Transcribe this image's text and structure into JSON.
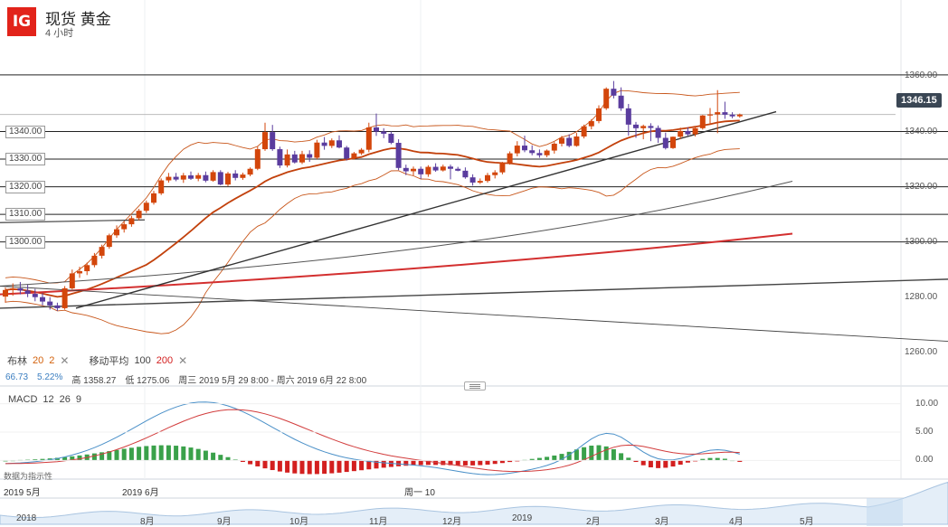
{
  "header": {
    "logo": "IG",
    "title": "现货 黄金",
    "timeframe": "4 小时"
  },
  "price_axis": {
    "labels": [
      {
        "text": "1360.00",
        "value": 1360,
        "boxed": false
      },
      {
        "text": "1340.00",
        "value": 1340,
        "boxed": false
      },
      {
        "text": "1320.00",
        "value": 1320,
        "boxed": false
      },
      {
        "text": "1300.00",
        "value": 1300,
        "boxed": false
      },
      {
        "text": "1280.00",
        "value": 1280,
        "boxed": false
      },
      {
        "text": "1260.00",
        "value": 1260,
        "boxed": false
      }
    ],
    "left_labels": [
      {
        "text": "1340.00",
        "value": 1340
      },
      {
        "text": "1330.00",
        "value": 1330
      },
      {
        "text": "1320.00",
        "value": 1320
      },
      {
        "text": "1310.00",
        "value": 1310
      },
      {
        "text": "1300.00",
        "value": 1300
      }
    ],
    "current_price": "1346.15"
  },
  "levels": [
    1360.5,
    1340,
    1330,
    1320,
    1310,
    1300
  ],
  "indicators_legend": {
    "bollinger": {
      "name": "布林",
      "p1": "20",
      "p2": "2"
    },
    "ma": {
      "name": "移动平均",
      "p1": "100",
      "p2": "200"
    },
    "close": "✕"
  },
  "stats": {
    "v1": "66.73",
    "v2": "5.22%",
    "high": "高 1358.27",
    "low": "低 1275.06",
    "range": "周三 2019 5月 29 8:00 - 周六 2019 6月 22 8:00"
  },
  "macd": {
    "label": "MACD",
    "p1": "12",
    "p2": "26",
    "p3": "9",
    "axis": [
      {
        "text": "10.00",
        "value": 10
      },
      {
        "text": "5.00",
        "value": 5
      },
      {
        "text": "0.00",
        "value": 0
      }
    ],
    "note": "数据为指示性"
  },
  "date_axis": [
    "2019 5月",
    "2019 6月",
    "周一 10"
  ],
  "navigator": [
    "2018",
    "8月",
    "9月",
    "10月",
    "11月",
    "12月",
    "2019",
    "2月",
    "3月",
    "4月",
    "5月"
  ],
  "colors": {
    "up": "#d3460b",
    "down": "#5a3c9e",
    "ma100": "#555555",
    "ma200": "#d32f2f",
    "bb": "#c8561a",
    "macd_pos": "#3aa14a",
    "macd_neg": "#d31f1f"
  },
  "chart_data": {
    "type": "candlestick",
    "ylim": [
      1256,
      1368
    ],
    "candles": [
      [
        1280.2,
        1283.5,
        1278,
        1282.6
      ],
      [
        1282.6,
        1285,
        1280.5,
        1283.2
      ],
      [
        1283.2,
        1285.5,
        1281,
        1282.4
      ],
      [
        1282.4,
        1284.5,
        1280,
        1281.2
      ],
      [
        1281.2,
        1283,
        1278.5,
        1280
      ],
      [
        1280,
        1281.5,
        1277,
        1278.4
      ],
      [
        1278.4,
        1280,
        1275.5,
        1277
      ],
      [
        1277,
        1278,
        1275,
        1276
      ],
      [
        1276,
        1284,
        1275.5,
        1283.2
      ],
      [
        1283.2,
        1290,
        1282.8,
        1288.6
      ],
      [
        1288.6,
        1291,
        1287,
        1289.4
      ],
      [
        1289.4,
        1292.5,
        1288,
        1291.6
      ],
      [
        1291.6,
        1296,
        1290.8,
        1295
      ],
      [
        1295,
        1299,
        1294,
        1298.2
      ],
      [
        1298.2,
        1303,
        1297.5,
        1302.4
      ],
      [
        1302.4,
        1306,
        1301.5,
        1304.6
      ],
      [
        1304.6,
        1307.5,
        1303.4,
        1306.4
      ],
      [
        1306.4,
        1309.5,
        1305.5,
        1308.6
      ],
      [
        1308.6,
        1312,
        1307.8,
        1311.3
      ],
      [
        1311.3,
        1315,
        1310.5,
        1314.2
      ],
      [
        1314.2,
        1318.5,
        1313.5,
        1317.6
      ],
      [
        1317.6,
        1323,
        1317,
        1322.3
      ],
      [
        1322.3,
        1325,
        1321.5,
        1323.6
      ],
      [
        1323.6,
        1325,
        1322,
        1322.6
      ],
      [
        1322.6,
        1325,
        1321.4,
        1324.1
      ],
      [
        1324.1,
        1325.5,
        1322.5,
        1322.9
      ],
      [
        1322.9,
        1325,
        1322,
        1324.2
      ],
      [
        1324.2,
        1325.5,
        1321.6,
        1322.2
      ],
      [
        1322.2,
        1326,
        1321.8,
        1325.3
      ],
      [
        1325.3,
        1326,
        1320.5,
        1320.8
      ],
      [
        1320.8,
        1325.4,
        1320.2,
        1324.8
      ],
      [
        1324.8,
        1326,
        1322.3,
        1323.2
      ],
      [
        1323.2,
        1325.1,
        1322.5,
        1324.4
      ],
      [
        1324.4,
        1327,
        1323.8,
        1326.5
      ],
      [
        1326.5,
        1334.5,
        1326,
        1333.6
      ],
      [
        1333.6,
        1343.2,
        1333,
        1339.8
      ],
      [
        1339.8,
        1342.4,
        1333,
        1333.6
      ],
      [
        1333.6,
        1334.5,
        1326.8,
        1327.7
      ],
      [
        1327.7,
        1333.5,
        1327,
        1331.7
      ],
      [
        1331.7,
        1333,
        1328.4,
        1328.8
      ],
      [
        1328.8,
        1333,
        1328.2,
        1331.8
      ],
      [
        1331.8,
        1333.2,
        1329,
        1330.5
      ],
      [
        1330.5,
        1337,
        1330,
        1336
      ],
      [
        1336,
        1338,
        1333.4,
        1334.8
      ],
      [
        1334.8,
        1337.5,
        1334,
        1336.8
      ],
      [
        1336.8,
        1338.6,
        1333.9,
        1334.2
      ],
      [
        1334.2,
        1334.8,
        1329.5,
        1330.2
      ],
      [
        1330.2,
        1332.6,
        1329.8,
        1332.1
      ],
      [
        1332.1,
        1334,
        1331.5,
        1333.4
      ],
      [
        1333.4,
        1343.2,
        1332.5,
        1341.5
      ],
      [
        1341.5,
        1346.5,
        1338.4,
        1340
      ],
      [
        1340,
        1341.2,
        1337.6,
        1339.2
      ],
      [
        1339.2,
        1340,
        1335.4,
        1335.9
      ],
      [
        1335.9,
        1337.2,
        1326,
        1326.8
      ],
      [
        1326.8,
        1328,
        1324.2,
        1325.6
      ],
      [
        1325.6,
        1327.3,
        1324.1,
        1326.5
      ],
      [
        1326.5,
        1327.3,
        1322.8,
        1324.5
      ],
      [
        1324.5,
        1327.8,
        1323.6,
        1327.2
      ],
      [
        1327.2,
        1328.5,
        1325.4,
        1325.9
      ],
      [
        1325.9,
        1328,
        1325.5,
        1327.3
      ],
      [
        1327.3,
        1328,
        1322.7,
        1326.5
      ],
      [
        1326.5,
        1327.2,
        1325.6,
        1325.8
      ],
      [
        1325.8,
        1327,
        1322.9,
        1323.4
      ],
      [
        1323.4,
        1324.5,
        1320.4,
        1321.5
      ],
      [
        1321.5,
        1323,
        1321,
        1322.1
      ],
      [
        1322.1,
        1325,
        1321.5,
        1324.2
      ],
      [
        1324.2,
        1326,
        1323,
        1325.2
      ],
      [
        1325.2,
        1329,
        1324.5,
        1328.7
      ],
      [
        1328.7,
        1332.8,
        1328,
        1332.1
      ],
      [
        1332.1,
        1336.5,
        1331,
        1334.9
      ],
      [
        1334.9,
        1338.5,
        1332.5,
        1333.2
      ],
      [
        1333.2,
        1335,
        1331.4,
        1332.2
      ],
      [
        1332.2,
        1333.5,
        1330.5,
        1331.4
      ],
      [
        1331.4,
        1333.5,
        1330.7,
        1333.1
      ],
      [
        1333.1,
        1336.2,
        1332,
        1335.6
      ],
      [
        1335.6,
        1338.4,
        1334.6,
        1337.7
      ],
      [
        1337.7,
        1339,
        1334.3,
        1334.8
      ],
      [
        1334.8,
        1339.5,
        1334.5,
        1338.2
      ],
      [
        1338.2,
        1342.5,
        1337.5,
        1341.9
      ],
      [
        1341.9,
        1344.5,
        1340.8,
        1343.8
      ],
      [
        1343.8,
        1349.5,
        1343,
        1348.4
      ],
      [
        1348.4,
        1356,
        1347.8,
        1355.5
      ],
      [
        1355.5,
        1358.3,
        1352,
        1353
      ],
      [
        1353,
        1356,
        1347.5,
        1348.4
      ],
      [
        1348.4,
        1350,
        1338.5,
        1342.5
      ],
      [
        1342.5,
        1343.5,
        1337.7,
        1341.2
      ],
      [
        1341.2,
        1342.5,
        1337.2,
        1342
      ],
      [
        1342,
        1343,
        1336.5,
        1341.3
      ],
      [
        1341.3,
        1342.2,
        1335.9,
        1337.7
      ],
      [
        1337.7,
        1339.6,
        1333.5,
        1334
      ],
      [
        1334,
        1338.2,
        1333.7,
        1338.1
      ],
      [
        1338.1,
        1341.4,
        1337.2,
        1340.2
      ],
      [
        1340.2,
        1341.5,
        1338.4,
        1339
      ],
      [
        1339,
        1342,
        1338.2,
        1341.2
      ],
      [
        1341.2,
        1346,
        1340.7,
        1345.8
      ],
      [
        1345.8,
        1348.5,
        1342.4,
        1346.2
      ],
      [
        1346.2,
        1355,
        1339.4,
        1347
      ],
      [
        1347,
        1350.8,
        1344.6,
        1346.1
      ],
      [
        1346.1,
        1347,
        1344.8,
        1345.5
      ],
      [
        1345.5,
        1346.5,
        1345,
        1346.15
      ]
    ]
  }
}
